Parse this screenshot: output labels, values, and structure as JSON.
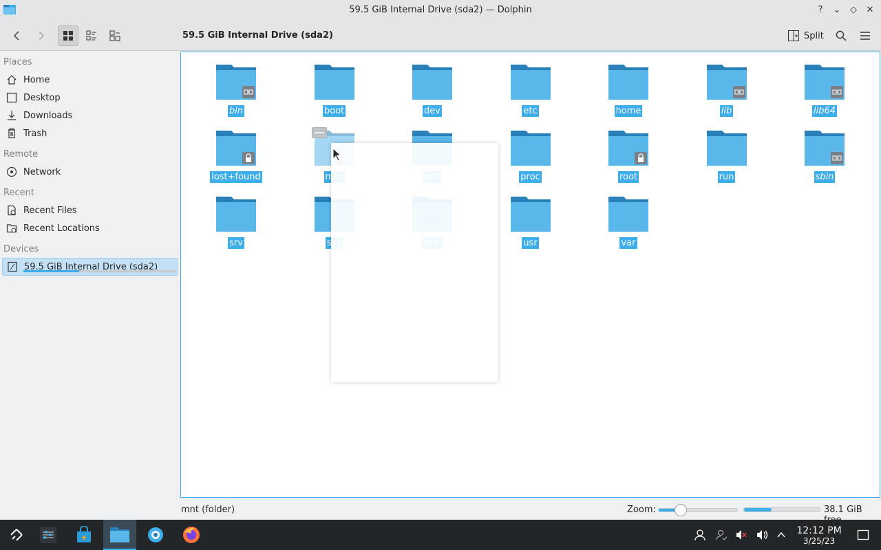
{
  "window": {
    "title": "59.5 GiB Internal Drive (sda2) — Dolphin",
    "buttons": [
      "?",
      "⌄",
      "◇",
      "✕"
    ]
  },
  "toolbar": {
    "breadcrumb": "59.5 GiB Internal Drive (sda2)",
    "split_label": "Split",
    "back_icon": "back-icon",
    "forward_icon": "forward-icon",
    "view_modes": [
      "icons-view",
      "compact-view",
      "details-view"
    ],
    "active_view": "icons-view"
  },
  "sidebar": {
    "sections": {
      "places": "Places",
      "remote": "Remote",
      "recent": "Recent",
      "devices": "Devices"
    },
    "places": [
      {
        "label": "Home",
        "icon": "home-icon"
      },
      {
        "label": "Desktop",
        "icon": "desktop-icon"
      },
      {
        "label": "Downloads",
        "icon": "download-icon"
      },
      {
        "label": "Trash",
        "icon": "trash-icon"
      }
    ],
    "remote": [
      {
        "label": "Network",
        "icon": "network-icon"
      }
    ],
    "recent": [
      {
        "label": "Recent Files",
        "icon": "recent-files-icon"
      },
      {
        "label": "Recent Locations",
        "icon": "recent-locations-icon"
      }
    ],
    "devices": [
      {
        "label": "59.5 GiB Internal Drive (sda2)",
        "icon": "drive-icon",
        "used_fraction": 0.36,
        "selected": true
      }
    ]
  },
  "files": [
    {
      "name": "bin",
      "italic": true,
      "emblem": "symlink"
    },
    {
      "name": "boot",
      "italic": false,
      "emblem": ""
    },
    {
      "name": "dev",
      "italic": false,
      "emblem": ""
    },
    {
      "name": "etc",
      "italic": false,
      "emblem": ""
    },
    {
      "name": "home",
      "italic": false,
      "emblem": ""
    },
    {
      "name": "lib",
      "italic": true,
      "emblem": "symlink"
    },
    {
      "name": "lib64",
      "italic": true,
      "emblem": "symlink"
    },
    {
      "name": "lost+found",
      "italic": false,
      "emblem": "lock"
    },
    {
      "name": "mnt",
      "italic": false,
      "emblem": "",
      "dragging": true
    },
    {
      "name": "opt",
      "italic": false,
      "emblem": ""
    },
    {
      "name": "proc",
      "italic": false,
      "emblem": ""
    },
    {
      "name": "root",
      "italic": false,
      "emblem": "lock"
    },
    {
      "name": "run",
      "italic": false,
      "emblem": ""
    },
    {
      "name": "sbin",
      "italic": true,
      "emblem": "symlink"
    },
    {
      "name": "srv",
      "italic": false,
      "emblem": ""
    },
    {
      "name": "sys",
      "italic": false,
      "emblem": ""
    },
    {
      "name": "tmp",
      "italic": false,
      "emblem": "clock"
    },
    {
      "name": "usr",
      "italic": false,
      "emblem": ""
    },
    {
      "name": "var",
      "italic": false,
      "emblem": ""
    }
  ],
  "statusbar": {
    "text": "mnt (folder)",
    "zoom_label": "Zoom:",
    "zoom_fraction": 0.28,
    "free_fraction": 0.36,
    "free_text": "38.1 GiB free"
  },
  "taskbar": {
    "apps": [
      "app-launcher-icon",
      "system-settings-icon",
      "discover-store-icon",
      "dolphin-icon",
      "settings-gear-icon",
      "firefox-icon"
    ],
    "active_app": "dolphin-icon",
    "tray": [
      "user-icon",
      "accounts-icon",
      "audio-muted-icon",
      "volume-icon",
      "tray-expand-icon"
    ],
    "time": "12:12 PM",
    "date": "3/25/23"
  },
  "colors": {
    "accent": "#3daee9",
    "folder": "#5ab7ea",
    "folder_dark": "#2980b9",
    "taskbar": "#232629"
  }
}
